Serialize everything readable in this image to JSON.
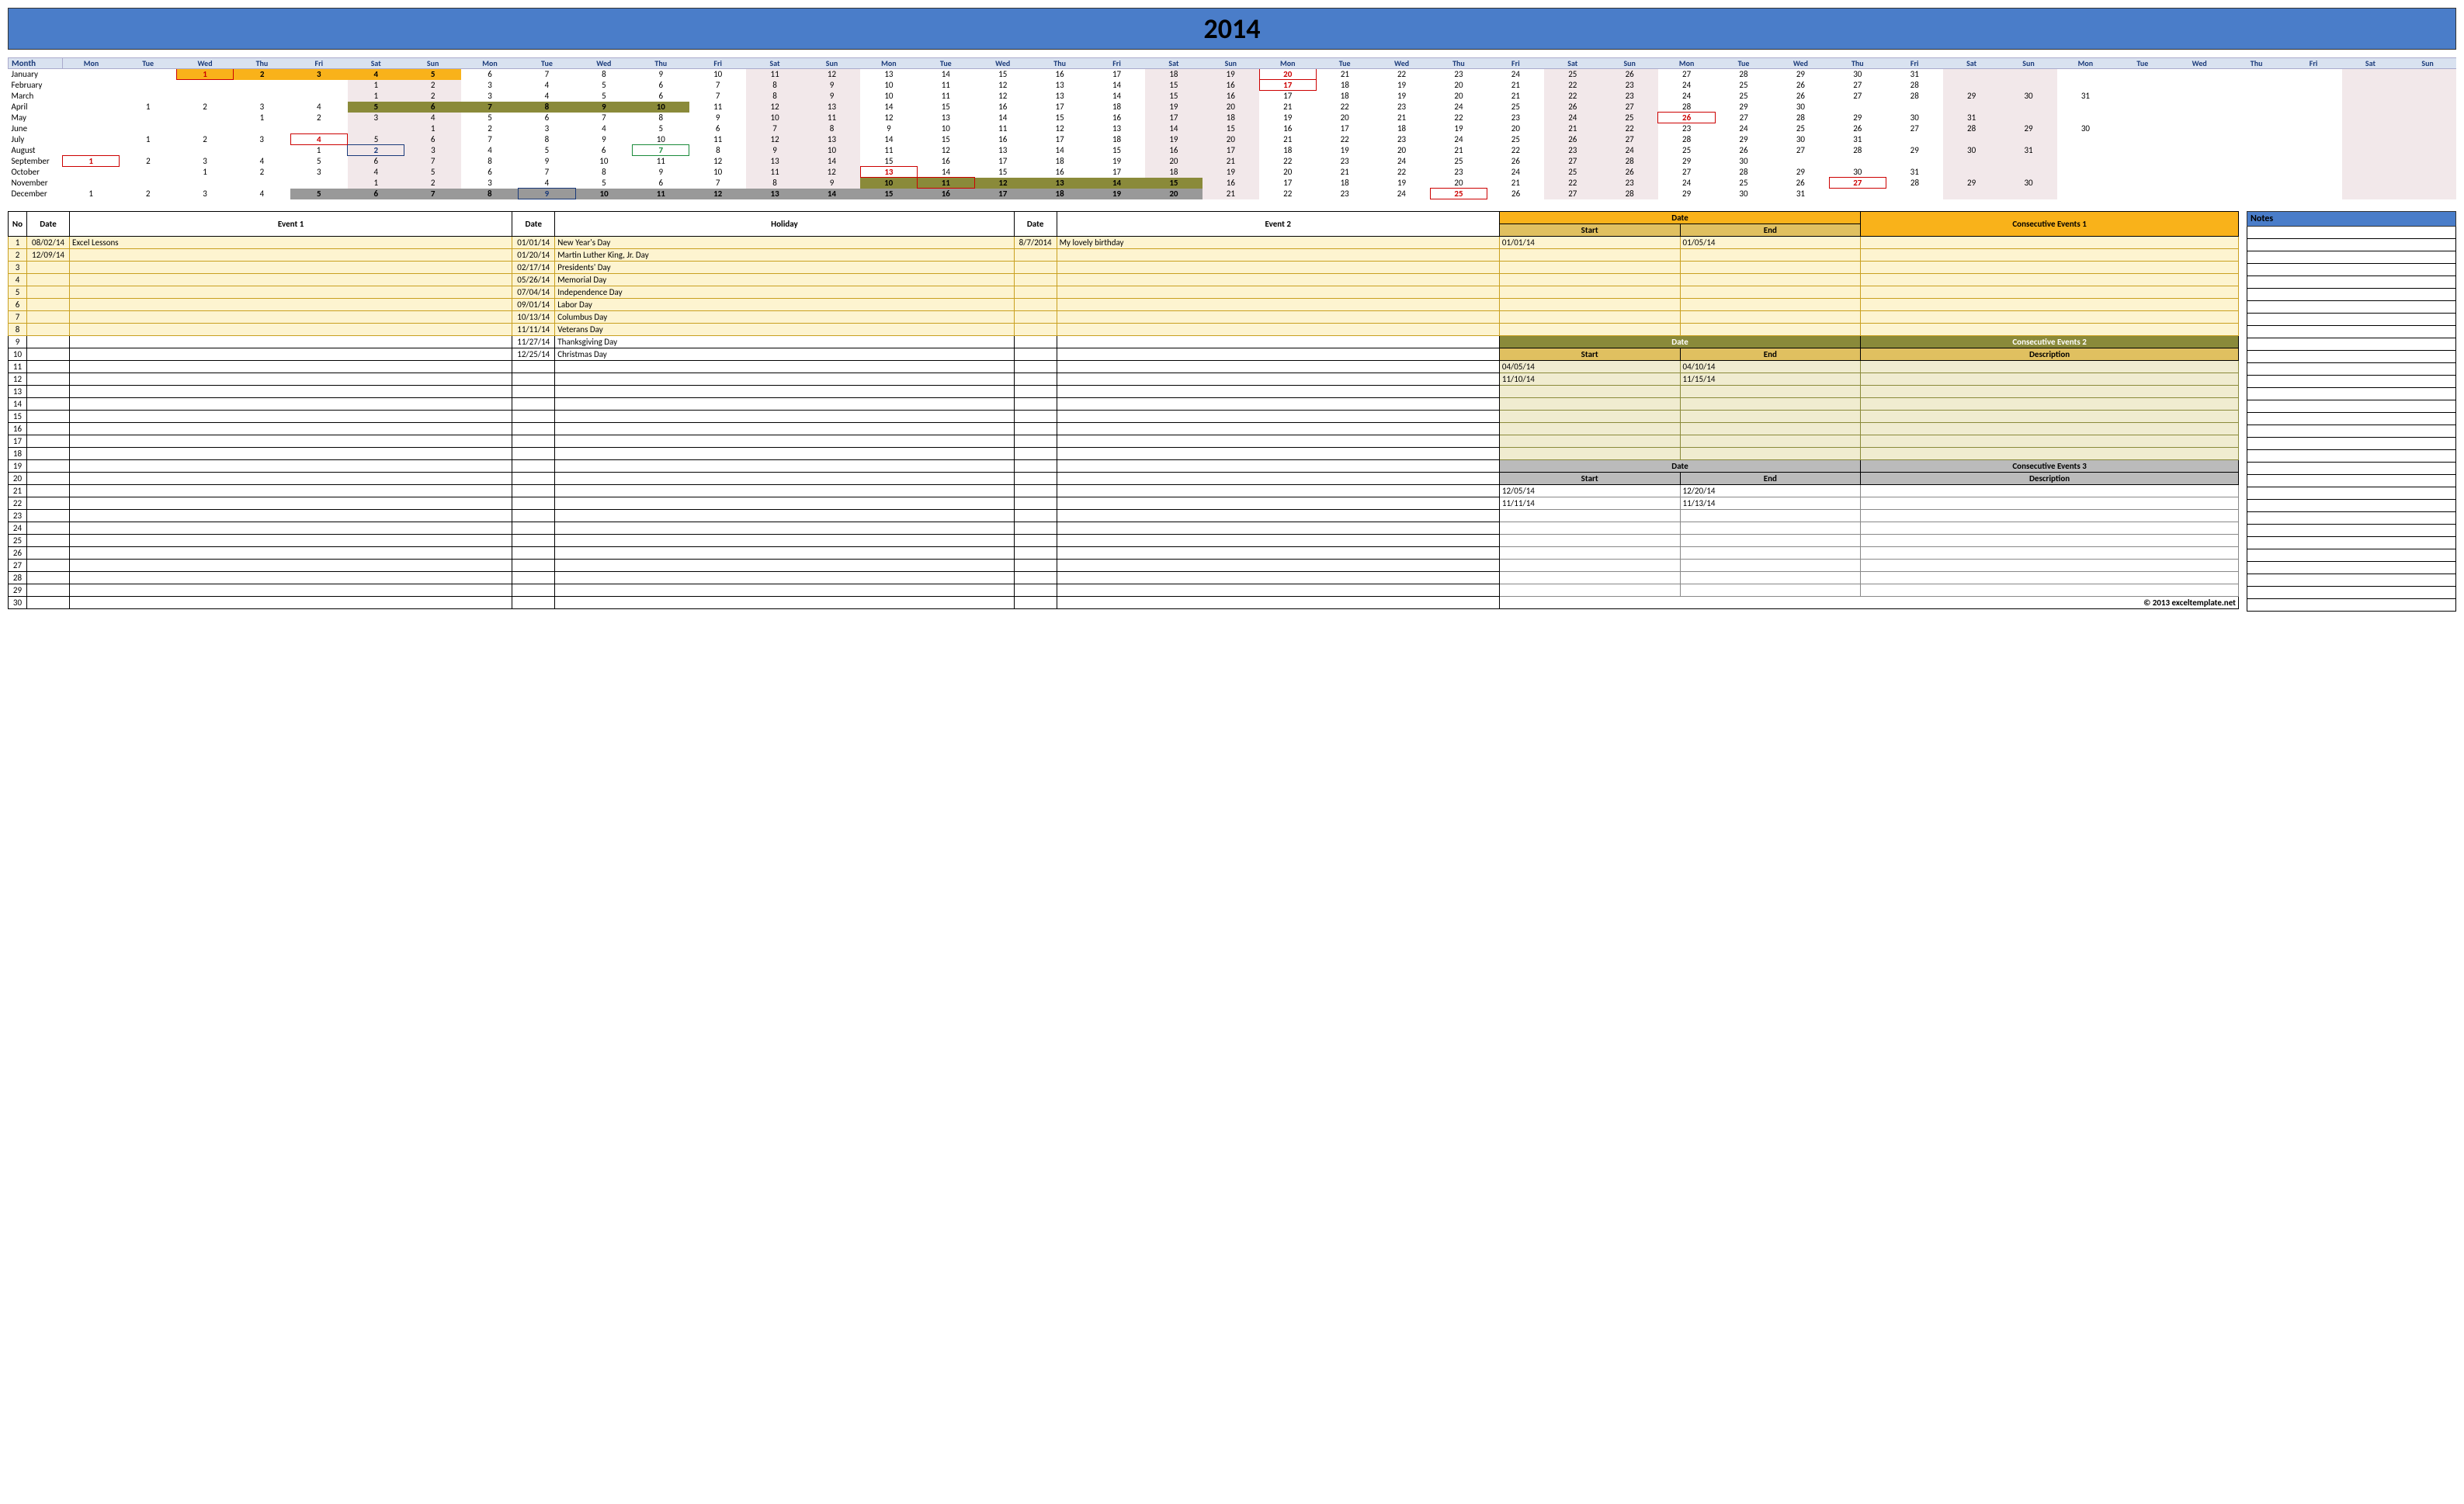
{
  "year": "2014",
  "dayHeaders": [
    "Mon",
    "Tue",
    "Wed",
    "Thu",
    "Fri",
    "Sat",
    "Sun",
    "Mon",
    "Tue",
    "Wed",
    "Thu",
    "Fri",
    "Sat",
    "Sun",
    "Mon",
    "Tue",
    "Wed",
    "Thu",
    "Fri",
    "Sat",
    "Sun",
    "Mon",
    "Tue",
    "Wed",
    "Thu",
    "Fri",
    "Sat",
    "Sun",
    "Mon",
    "Tue",
    "Wed",
    "Thu",
    "Fri",
    "Sat",
    "Sun",
    "Mon",
    "Tue",
    "Wed",
    "Thu",
    "Fri",
    "Sat",
    "Sun"
  ],
  "monthLabel": "Month",
  "months": [
    {
      "name": "January",
      "offset": 2,
      "days": 31,
      "marks": {
        "1": "holiday ce1",
        "2": "ce1",
        "3": "ce1",
        "4": "ce1",
        "5": "ce1",
        "20": "holiday"
      }
    },
    {
      "name": "February",
      "offset": 5,
      "days": 28,
      "marks": {
        "17": "holiday"
      }
    },
    {
      "name": "March",
      "offset": 5,
      "days": 31,
      "marks": {}
    },
    {
      "name": "April",
      "offset": 1,
      "days": 30,
      "marks": {
        "5": "ce2",
        "6": "ce2",
        "7": "ce2",
        "8": "ce2",
        "9": "ce2",
        "10": "ce2"
      }
    },
    {
      "name": "May",
      "offset": 3,
      "days": 31,
      "marks": {
        "26": "holiday"
      }
    },
    {
      "name": "June",
      "offset": 6,
      "days": 30,
      "marks": {}
    },
    {
      "name": "July",
      "offset": 1,
      "days": 31,
      "marks": {
        "4": "holiday"
      }
    },
    {
      "name": "August",
      "offset": 4,
      "days": 31,
      "marks": {
        "2": "ev1",
        "7": "ev2"
      }
    },
    {
      "name": "September",
      "offset": 0,
      "days": 30,
      "marks": {
        "1": "holiday"
      }
    },
    {
      "name": "October",
      "offset": 2,
      "days": 31,
      "marks": {
        "13": "holiday"
      }
    },
    {
      "name": "November",
      "offset": 5,
      "days": 30,
      "marks": {
        "10": "ce2",
        "11": "holiday ce2",
        "12": "ce2",
        "13": "ce2",
        "14": "ce2",
        "15": "ce2",
        "27": "holiday"
      }
    },
    {
      "name": "December",
      "offset": 0,
      "days": 31,
      "marks": {
        "5": "ce3",
        "6": "ce3",
        "7": "ce3",
        "8": "ce3",
        "9": "ev1 ce3",
        "10": "ce3",
        "11": "ce3",
        "12": "ce3",
        "13": "ce3",
        "14": "ce3",
        "15": "ce3",
        "16": "ce3",
        "17": "ce3",
        "18": "ce3",
        "19": "ce3",
        "20": "ce3",
        "25": "holiday"
      }
    }
  ],
  "eventHeaders": {
    "no": "No",
    "date": "Date",
    "event1": "Event 1",
    "holiday": "Holiday",
    "event2": "Event 2",
    "ceDate": "Date",
    "ceStart": "Start",
    "ceEnd": "End",
    "ceDesc": "Description",
    "ce1": "Consecutive Events 1",
    "ce2": "Consecutive Events 2",
    "ce3": "Consecutive Events 3"
  },
  "event1Rows": [
    {
      "date": "08/02/14",
      "text": "Excel Lessons"
    },
    {
      "date": "12/09/14",
      "text": ""
    }
  ],
  "holidayRows": [
    {
      "date": "01/01/14",
      "text": "New Year's Day"
    },
    {
      "date": "01/20/14",
      "text": "Martin Luther King, Jr. Day"
    },
    {
      "date": "02/17/14",
      "text": "Presidents' Day"
    },
    {
      "date": "05/26/14",
      "text": "Memorial Day"
    },
    {
      "date": "07/04/14",
      "text": "Independence Day"
    },
    {
      "date": "09/01/14",
      "text": "Labor Day"
    },
    {
      "date": "10/13/14",
      "text": "Columbus Day"
    },
    {
      "date": "11/11/14",
      "text": "Veterans Day"
    },
    {
      "date": "11/27/14",
      "text": "Thanksgiving Day"
    },
    {
      "date": "12/25/14",
      "text": "Christmas Day"
    }
  ],
  "event2Rows": [
    {
      "date": "8/7/2014",
      "text": "My lovely birthday"
    }
  ],
  "ce1Rows": [
    {
      "start": "01/01/14",
      "end": "01/05/14",
      "desc": ""
    }
  ],
  "ce2Rows": [
    {
      "start": "04/05/14",
      "end": "04/10/14",
      "desc": ""
    },
    {
      "start": "11/10/14",
      "end": "11/15/14",
      "desc": ""
    }
  ],
  "ce3Rows": [
    {
      "start": "12/05/14",
      "end": "12/20/14",
      "desc": ""
    },
    {
      "start": "11/11/14",
      "end": "11/13/14",
      "desc": ""
    }
  ],
  "notesLabel": "Notes",
  "totalRows": 30,
  "footer": "© 2013 exceltemplate.net"
}
